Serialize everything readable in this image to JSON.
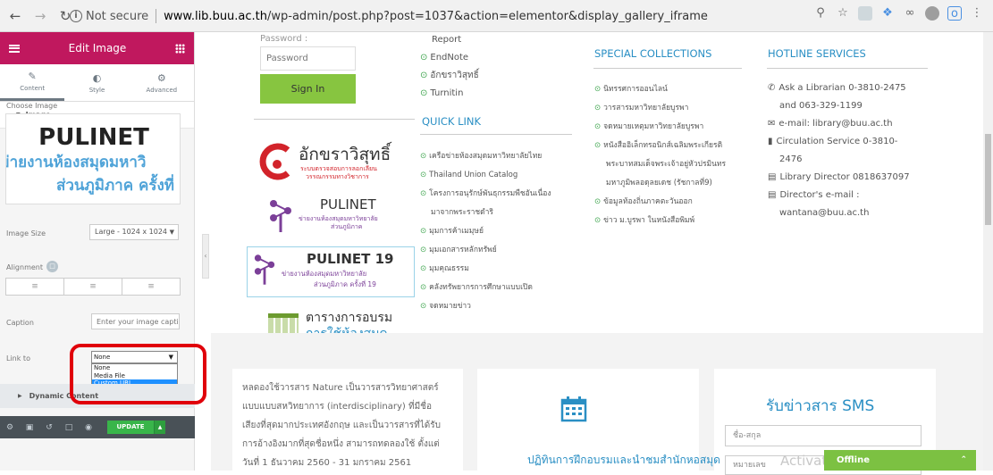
{
  "browser": {
    "security_label": "Not secure",
    "url_host": "www.lib.buu.ac.th",
    "url_path": "/wp-admin/post.php?post=1037&action=elementor&display_gallery_iframe"
  },
  "panel": {
    "title": "Edit Image",
    "tabs": [
      {
        "label": "Content",
        "icon": "pencil-icon"
      },
      {
        "label": "Style",
        "icon": "half-circle-icon"
      },
      {
        "label": "Advanced",
        "icon": "gear-icon"
      }
    ],
    "section_title": "Image",
    "choose_image_label": "Choose Image",
    "preview": {
      "title": "PULINET",
      "line1": "ข่ายงานห้องสมุดมหาวิ",
      "line2": "ส่วนภูมิภาค ครั้งที่"
    },
    "image_size_label": "Image Size",
    "image_size_value": "Large - 1024 x 1024",
    "alignment_label": "Alignment",
    "caption_label": "Caption",
    "caption_placeholder": "Enter your image captic",
    "link_to_label": "Link to",
    "link_to_value": "None",
    "link_to_options": [
      "None",
      "Media File",
      "Custom URL"
    ],
    "link_to_highlighted": "Custom URL",
    "dynamic_content_label": "Dynamic Content",
    "update_label": "UPDATE"
  },
  "site": {
    "password_label": "Password :",
    "password_placeholder": "Password",
    "signin_label": "Sign In",
    "col1": {
      "top_item": "Report",
      "links_top": [
        "EndNote",
        "อักขราวิสุทธิ์",
        "Turnitin"
      ],
      "quick_link_title": "QUICK LINK",
      "quick_links": [
        "เครือข่ายห้องสมุดมหาวิทยาลัยไทย",
        "Thailand Union Catalog",
        "โครงการอนุรักษ์พันธุกรรมพืชอันเนื่อง",
        "มาจากพระราชดำริ",
        "มุมการค้าเมมุษย์",
        "มุมเอกสารหลักทรัพย์",
        "มุมคุณธรรม",
        "คลังทรัพยากรการศึกษาแบบเปิด",
        "จดหมายข่าว"
      ]
    },
    "col2": {
      "title": "SPECIAL COLLECTIONS",
      "links": [
        "นิทรรศการออนไลน์",
        "วารสารมหาวิทยาลัยบูรพา",
        "จดหมายเหตุมหาวิทยาลัยบูรพา",
        "หนังสืออิเล็กทรอนิกส์เฉลิมพระเกียรติ",
        "พระบาทสมเด็จพระเจ้าอยู่หัวปรมินทร",
        "มหาภูมิพลอดุลยเดช (รัชกาลที่9)",
        "ข้อมูลท้องถิ่นภาคตะวันออก",
        "ข่าว ม.บูรพา ในหนังสือพิมพ์"
      ]
    },
    "col3": {
      "title": "HOTLINE SERVICES",
      "items": [
        {
          "icon": "phone-icon",
          "text": "Ask a Librarian 0-3810-2475"
        },
        {
          "icon": "",
          "text": "and 063-329-1199"
        },
        {
          "icon": "mail-icon",
          "text": "e-mail: library@buu.ac.th"
        },
        {
          "icon": "book-icon",
          "text": "Circulation Service 0-3810-"
        },
        {
          "icon": "",
          "text": "2476"
        },
        {
          "icon": "card-icon",
          "text": "Library Director 0818637097"
        },
        {
          "icon": "card-icon",
          "text": "Director's e-mail :"
        },
        {
          "icon": "",
          "text": "wantana@buu.ac.th"
        }
      ]
    },
    "logos": {
      "aksara_title": "อักขราวิสุทธิ์",
      "aksara_sub1": "ระบบตรวจสอบการลอกเลียน",
      "aksara_sub2": "วรรณกรรมทางวิชาการ",
      "pulinet_title": "PULINET",
      "pulinet_sub1": "ข่ายงานห้องสมุดมหาวิทยาลัย",
      "pulinet_sub2": "ส่วนภูมิภาค",
      "pulinet19_title": "PULINET 19",
      "pulinet19_sub1": "ข่ายงานห้องสมุดมหาวิทยาลัย",
      "pulinet19_sub2": "ส่วนภูมิภาค ครั้งที่ 19",
      "training_title": "ตารางการอบรม",
      "training_sub": "การใช้ห้องสมุด"
    },
    "news_text": "หลดองใช้วารสาร Nature เป็นวารสารวิทยาศาสตร์ แบบแบบสหวิทยาการ (interdisciplinary) ที่มีชื่อเสียงที่สุดมากประเทศอังกฤษ และเป็นวารสารที่ได้รับการอ้างอิงมากที่สุดชื่อหนึ่ง สามารถทดลองใช้ ตั้งแต่วันที่ 1 ธันวาคม 2560 - 31 มกราคม 2561",
    "card2_title": "ปฏิทินการฝึกอบรมและนำชมสำนักหอสมุด",
    "sms_title": "รับข่าวสาร SMS",
    "sms_name_placeholder": "ชื่อ-สกุล",
    "sms_phone_placeholder": "หมายเลข",
    "watermark": "Activate Windows",
    "chat_label": "Offline"
  }
}
